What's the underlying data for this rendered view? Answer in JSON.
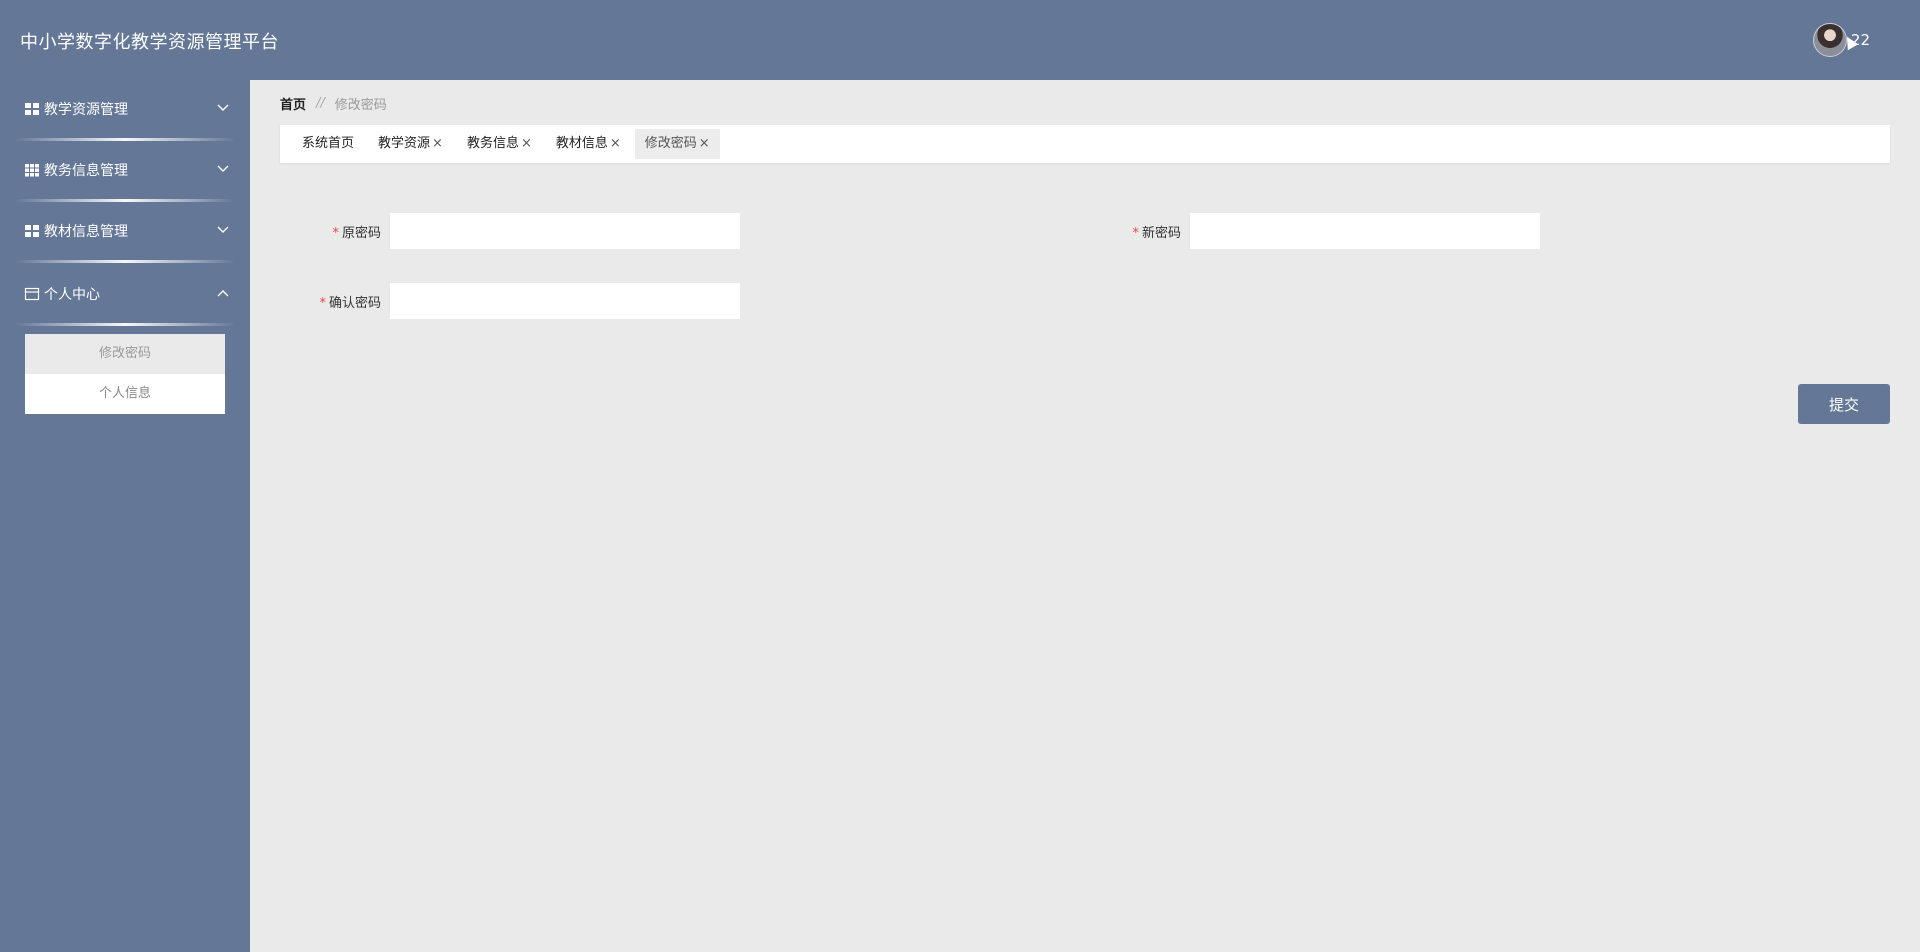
{
  "header": {
    "title": "中小学数字化教学资源管理平台",
    "user_name": "22"
  },
  "sidebar": {
    "items": [
      {
        "label": "教学资源管理",
        "icon": "grid-icon",
        "expanded": false
      },
      {
        "label": "教务信息管理",
        "icon": "table-grid-icon",
        "expanded": false
      },
      {
        "label": "教材信息管理",
        "icon": "grid-icon",
        "expanded": false
      },
      {
        "label": "个人中心",
        "icon": "card-icon",
        "expanded": true
      }
    ],
    "submenu": [
      {
        "label": "修改密码",
        "active": true
      },
      {
        "label": "个人信息",
        "active": false
      }
    ]
  },
  "breadcrumb": {
    "home": "首页",
    "separator": "//",
    "current": "修改密码"
  },
  "tabs": [
    {
      "label": "系统首页",
      "closable": false,
      "active": false
    },
    {
      "label": "教学资源",
      "closable": true,
      "active": false
    },
    {
      "label": "教务信息",
      "closable": true,
      "active": false
    },
    {
      "label": "教材信息",
      "closable": true,
      "active": false
    },
    {
      "label": "修改密码",
      "closable": true,
      "active": true
    }
  ],
  "form": {
    "required_mark": "*",
    "old_password": {
      "label": "原密码",
      "value": ""
    },
    "new_password": {
      "label": "新密码",
      "value": ""
    },
    "confirm_password": {
      "label": "确认密码",
      "value": ""
    },
    "submit_label": "提交"
  },
  "colors": {
    "primary": "#647797",
    "background": "#eaeaea",
    "required": "#e74c3c"
  }
}
